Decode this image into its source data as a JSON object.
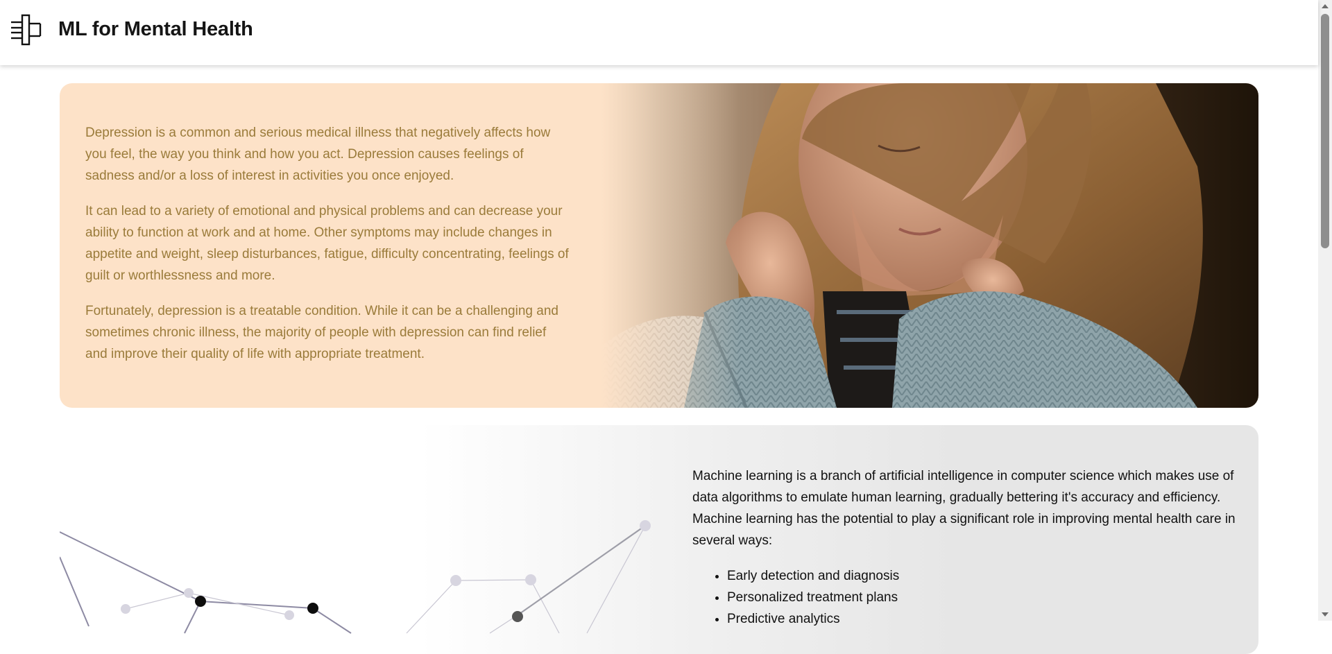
{
  "header": {
    "title": "ML for Mental Health",
    "logo_icon": "circuit-logo-icon"
  },
  "hero": {
    "paragraphs": [
      "Depression is a common and serious medical illness that negatively affects how you feel, the way you think and how you act. Depression causes feelings of sadness and/or a loss of interest in activities you once enjoyed.",
      "It can lead to a variety of emotional and physical problems and can decrease your ability to function at work and at home. Other symptoms may include changes in appetite and weight, sleep disturbances, fatigue, difficulty concentrating, feelings of guilt or worthlessness and more.",
      "Fortunately, depression is a treatable condition. While it can be a challenging and sometimes chronic illness, the majority of people with depression can find relief and improve their quality of life with appropriate treatment."
    ],
    "background_color": "#fde2c8",
    "text_color": "#9a7b3a",
    "image_subject": "woman-in-knit-sweater-photo"
  },
  "ml_section": {
    "intro": "Machine learning is a branch of artificial intelligence in computer science which makes use of data algorithms to emulate human learning, gradually bettering it's accuracy and efficiency. Machine learning has the potential to play a significant role in improving mental health care in several ways:",
    "list": [
      "Early detection and diagnosis",
      "Personalized treatment plans",
      "Predictive analytics"
    ],
    "image_subject": "network-graph-illustration"
  }
}
